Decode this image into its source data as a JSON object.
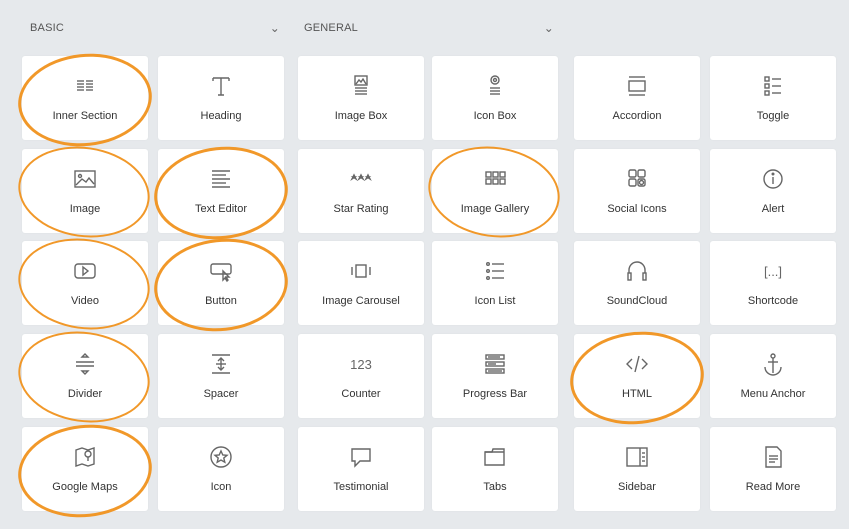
{
  "accent_color": "#f0921e",
  "categories": [
    {
      "label": "BASIC",
      "icon": "chevron-down-icon"
    },
    {
      "label": "GENERAL",
      "icon": "chevron-down-icon"
    }
  ],
  "widgets": [
    {
      "label": "Inner Section",
      "icon": "inner-section-icon"
    },
    {
      "label": "Heading",
      "icon": "heading-icon"
    },
    {
      "label": "Image Box",
      "icon": "image-box-icon"
    },
    {
      "label": "Icon Box",
      "icon": "icon-box-icon"
    },
    {
      "label": "Accordion",
      "icon": "accordion-icon"
    },
    {
      "label": "Toggle",
      "icon": "toggle-icon"
    },
    {
      "label": "Image",
      "icon": "image-icon"
    },
    {
      "label": "Text Editor",
      "icon": "text-editor-icon"
    },
    {
      "label": "Star Rating",
      "icon": "star-rating-icon"
    },
    {
      "label": "Image Gallery",
      "icon": "image-gallery-icon"
    },
    {
      "label": "Social Icons",
      "icon": "social-icons-icon"
    },
    {
      "label": "Alert",
      "icon": "alert-icon"
    },
    {
      "label": "Video",
      "icon": "video-icon"
    },
    {
      "label": "Button",
      "icon": "button-icon"
    },
    {
      "label": "Image Carousel",
      "icon": "image-carousel-icon"
    },
    {
      "label": "Icon List",
      "icon": "icon-list-icon"
    },
    {
      "label": "SoundCloud",
      "icon": "soundcloud-icon"
    },
    {
      "label": "Shortcode",
      "icon": "shortcode-icon",
      "glyph": "[...]"
    },
    {
      "label": "Divider",
      "icon": "divider-icon"
    },
    {
      "label": "Spacer",
      "icon": "spacer-icon"
    },
    {
      "label": "Counter",
      "icon": "counter-icon",
      "glyph": "123"
    },
    {
      "label": "Progress Bar",
      "icon": "progress-bar-icon"
    },
    {
      "label": "HTML",
      "icon": "html-icon"
    },
    {
      "label": "Menu Anchor",
      "icon": "anchor-icon"
    },
    {
      "label": "Google Maps",
      "icon": "google-maps-icon"
    },
    {
      "label": "Icon",
      "icon": "star-circle-icon"
    },
    {
      "label": "Testimonial",
      "icon": "testimonial-icon"
    },
    {
      "label": "Tabs",
      "icon": "tabs-icon"
    },
    {
      "label": "Sidebar",
      "icon": "sidebar-icon"
    },
    {
      "label": "Read More",
      "icon": "read-more-icon"
    }
  ],
  "highlighted": [
    "Inner Section",
    "Image",
    "Text Editor",
    "Video",
    "Button",
    "Divider",
    "Google Maps",
    "Image Gallery",
    "HTML"
  ]
}
